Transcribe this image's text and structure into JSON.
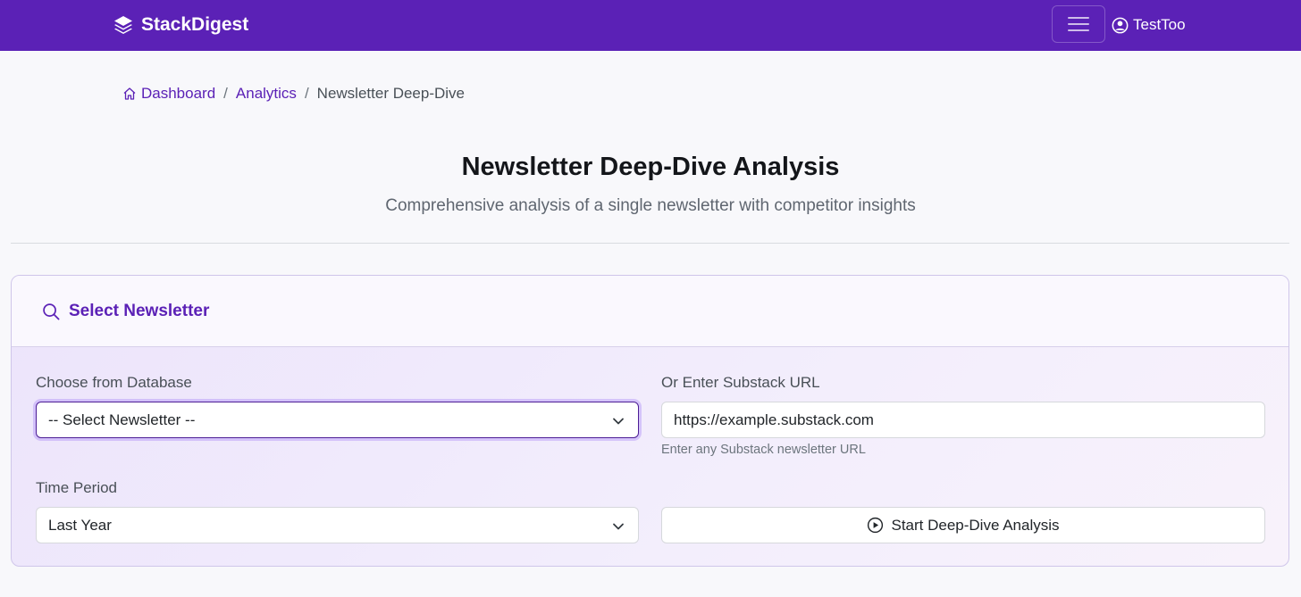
{
  "navbar": {
    "brand": "StackDigest",
    "user": "TestToo",
    "brand_color": "#5b21b6"
  },
  "breadcrumb": {
    "items": [
      "Dashboard",
      "Analytics",
      "Newsletter Deep-Dive"
    ],
    "separator": "/"
  },
  "header": {
    "title": "Newsletter Deep-Dive Analysis",
    "subtitle": "Comprehensive analysis of a single newsletter with competitor insights"
  },
  "card": {
    "title": "Select Newsletter",
    "database_label": "Choose from Database",
    "database_selected": "-- Select Newsletter --",
    "url_label": "Or Enter Substack URL",
    "url_placeholder": "https://example.substack.com",
    "url_help": "Enter any Substack newsletter URL",
    "period_label": "Time Period",
    "period_selected": "Last Year",
    "start_button": "Start Deep-Dive Analysis"
  },
  "icons": {
    "brand": "layers-icon",
    "menu": "hamburger-icon",
    "user": "person-circle-icon",
    "home": "house-icon",
    "search": "search-icon",
    "chevron": "chevron-down-icon",
    "play": "play-circle-icon"
  }
}
